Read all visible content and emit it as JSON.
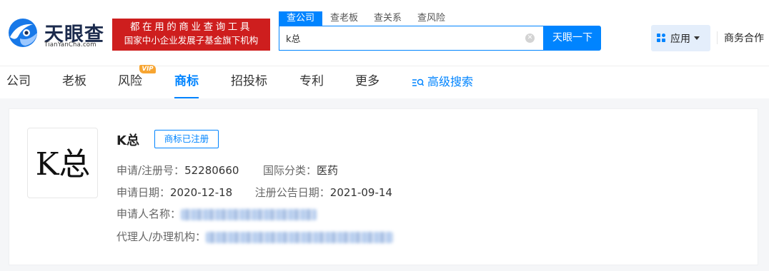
{
  "header": {
    "logo_cn": "天眼查",
    "logo_en": "TianYanCha.com",
    "banner_line1": "都在用的商业查询工具",
    "banner_line2": "国家中小企业发展子基金旗下机构",
    "search_tabs": [
      "查公司",
      "查老板",
      "查关系",
      "查风险"
    ],
    "search_value": "k总",
    "search_button": "天眼一下",
    "apps_label": "应用",
    "biz_link": "商务合作"
  },
  "nav": {
    "items": [
      "公司",
      "老板",
      "风险",
      "商标",
      "招投标",
      "专利",
      "更多"
    ],
    "active": "商标",
    "vip_badge": "VIP",
    "advanced_search": "高级搜索"
  },
  "result": {
    "image_text": "K总",
    "name": "K总",
    "status": "商标已注册",
    "reg_no_label": "申请/注册号：",
    "reg_no": "52280660",
    "intl_class_label": "国际分类：",
    "intl_class": "医药",
    "apply_date_label": "申请日期：",
    "apply_date": "2020-12-18",
    "announce_date_label": "注册公告日期：",
    "announce_date": "2021-09-14",
    "applicant_label": "申请人名称：",
    "agent_label": "代理人/办理机构："
  },
  "colors": {
    "brand_blue": "#0084ff",
    "banner_red": "#ce1e1e",
    "vip_orange": "#f7a531"
  }
}
